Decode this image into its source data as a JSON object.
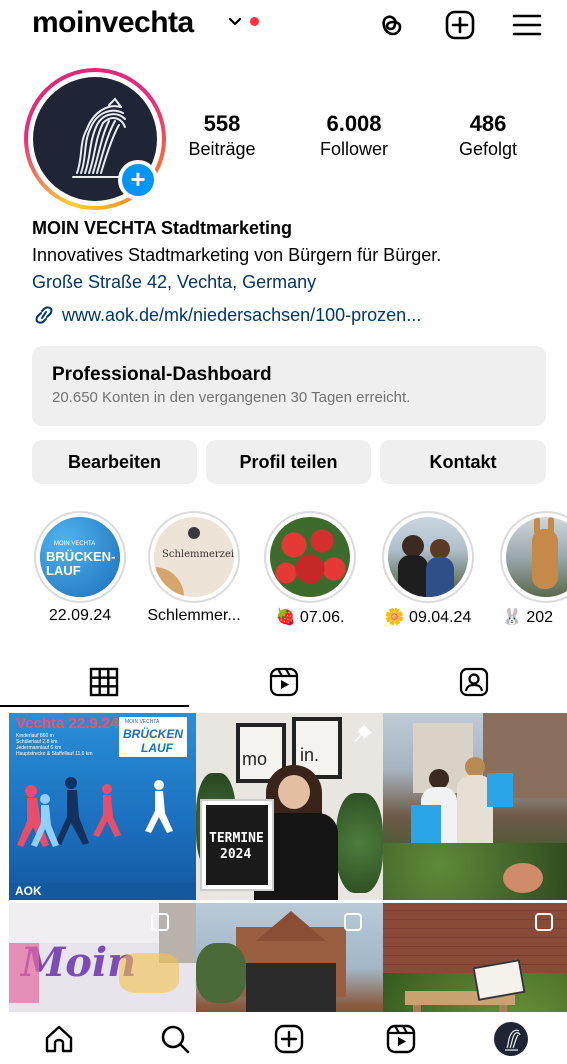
{
  "header": {
    "username": "moinvechta"
  },
  "profile": {
    "stats": [
      {
        "value": "558",
        "label": "Beiträge"
      },
      {
        "value": "6.008",
        "label": "Follower"
      },
      {
        "value": "486",
        "label": "Gefolgt"
      }
    ],
    "name": "MOIN VECHTA Stadtmarketing",
    "bio": "Innovatives Stadtmarketing von Bürgern für Bürger.",
    "location": "Große Straße 42, Vechta, Germany",
    "link": "www.aok.de/mk/niedersachsen/100-prozen..."
  },
  "dashboard": {
    "title": "Professional-Dashboard",
    "subtitle": "20.650 Konten in den vergangenen 30 Tagen erreicht."
  },
  "buttons": {
    "edit": "Bearbeiten",
    "share": "Profil teilen",
    "contact": "Kontakt"
  },
  "highlights": [
    {
      "label": "22.09.24",
      "img_text_1": "MOIN VECHTA",
      "img_text_2": "BRÜCKEN-",
      "img_text_3": "LAUF"
    },
    {
      "label": "Schlemmer...",
      "img_text_1": "Schlemmerzeit"
    },
    {
      "label": "🍓 07.06."
    },
    {
      "label": "🌼 09.04.24"
    },
    {
      "label": "🐰 202"
    }
  ],
  "grid": {
    "post1": {
      "title": "Vechta 22.9.24",
      "lines": [
        "Kinderlauf 860 m",
        "Schülerlauf 2,8 km",
        "Jedermannlauf 6 km",
        "Hauptstrecke & Staffellauf 11,6 km"
      ],
      "logo_top": "MOIN VECHTA",
      "logo_main": "BRÜCKEN",
      "logo_sub": "LAUF",
      "sponsor": "AOK"
    },
    "post2": {
      "sign_left": "mo",
      "sign_right": "in.",
      "board_1": "TERMINE",
      "board_2": "2024"
    },
    "post4": {
      "graffiti": "Moin"
    }
  },
  "colors": {
    "accent": "#0095f6",
    "link": "#00376b",
    "notification": "#ff3040",
    "button_bg": "#efefef"
  },
  "icons": {
    "top": [
      "chevron-down-icon",
      "threads-icon",
      "new-post-icon",
      "menu-icon"
    ],
    "tabs": [
      "grid-icon",
      "reels-icon",
      "tagged-icon"
    ],
    "nav": [
      "home-icon",
      "search-icon",
      "create-icon",
      "reels-icon",
      "profile-icon"
    ]
  }
}
